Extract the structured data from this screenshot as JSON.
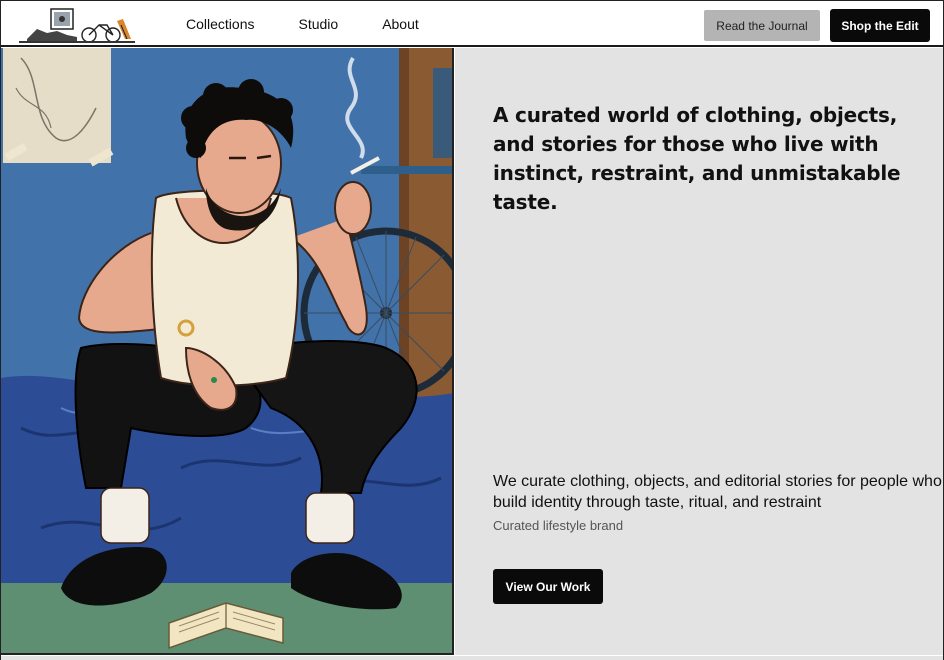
{
  "nav": {
    "links": [
      "Collections",
      "Studio",
      "About"
    ],
    "journal_button": "Read the Journal",
    "shop_button": "Shop the Edit"
  },
  "hero": {
    "headline": "A curated world of clothing, objects, and stories for those who live with instinct, restraint, and unmistakable taste.",
    "subcopy": "We curate clothing, objects, and editorial stories for people who build identity through taste, ritual, and restraint",
    "tagline": "Curated lifestyle brand",
    "cta": "View Our Work"
  },
  "colors": {
    "accent": "#0a0a0a",
    "secondary_button": "#b4b4b4",
    "panel": "#e3e3e3",
    "wall": "#3f6fa8"
  }
}
